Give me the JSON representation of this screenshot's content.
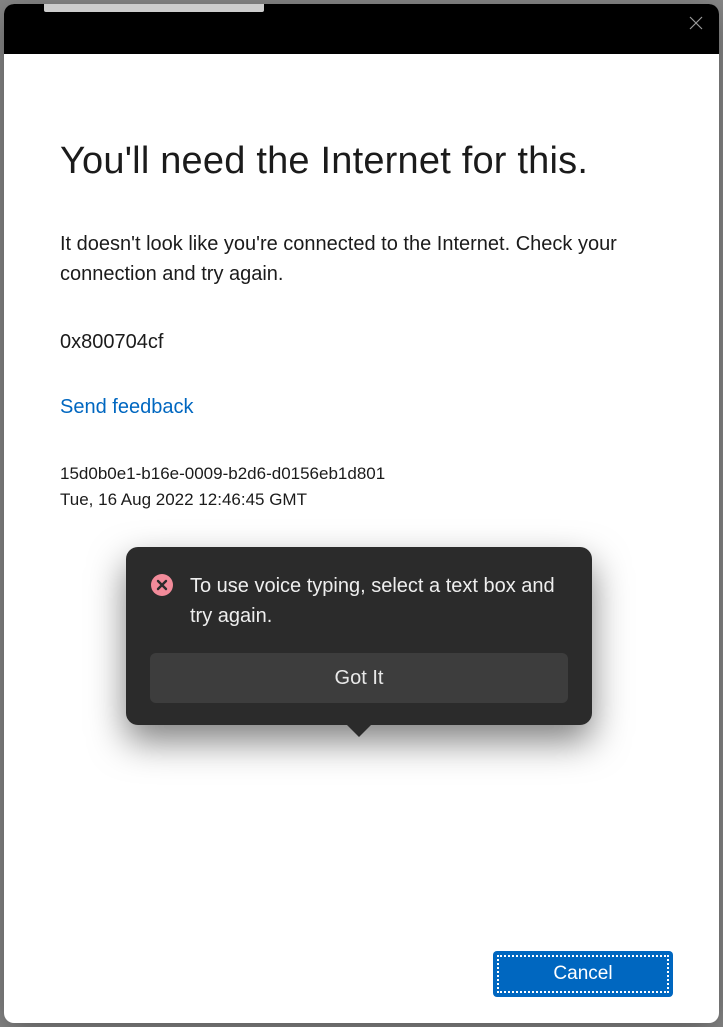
{
  "dialog": {
    "title": "You'll need the Internet for this.",
    "body": "It doesn't look like you're connected to the Internet. Check your connection and try again.",
    "error_code": "0x800704cf",
    "feedback_link": "Send feedback",
    "request_id": "15d0b0e1-b16e-0009-b2d6-d0156eb1d801",
    "timestamp": "Tue, 16 Aug 2022 12:46:45 GMT",
    "cancel_label": "Cancel"
  },
  "toast": {
    "message": "To use voice typing, select a text box and try again.",
    "button": "Got It"
  }
}
